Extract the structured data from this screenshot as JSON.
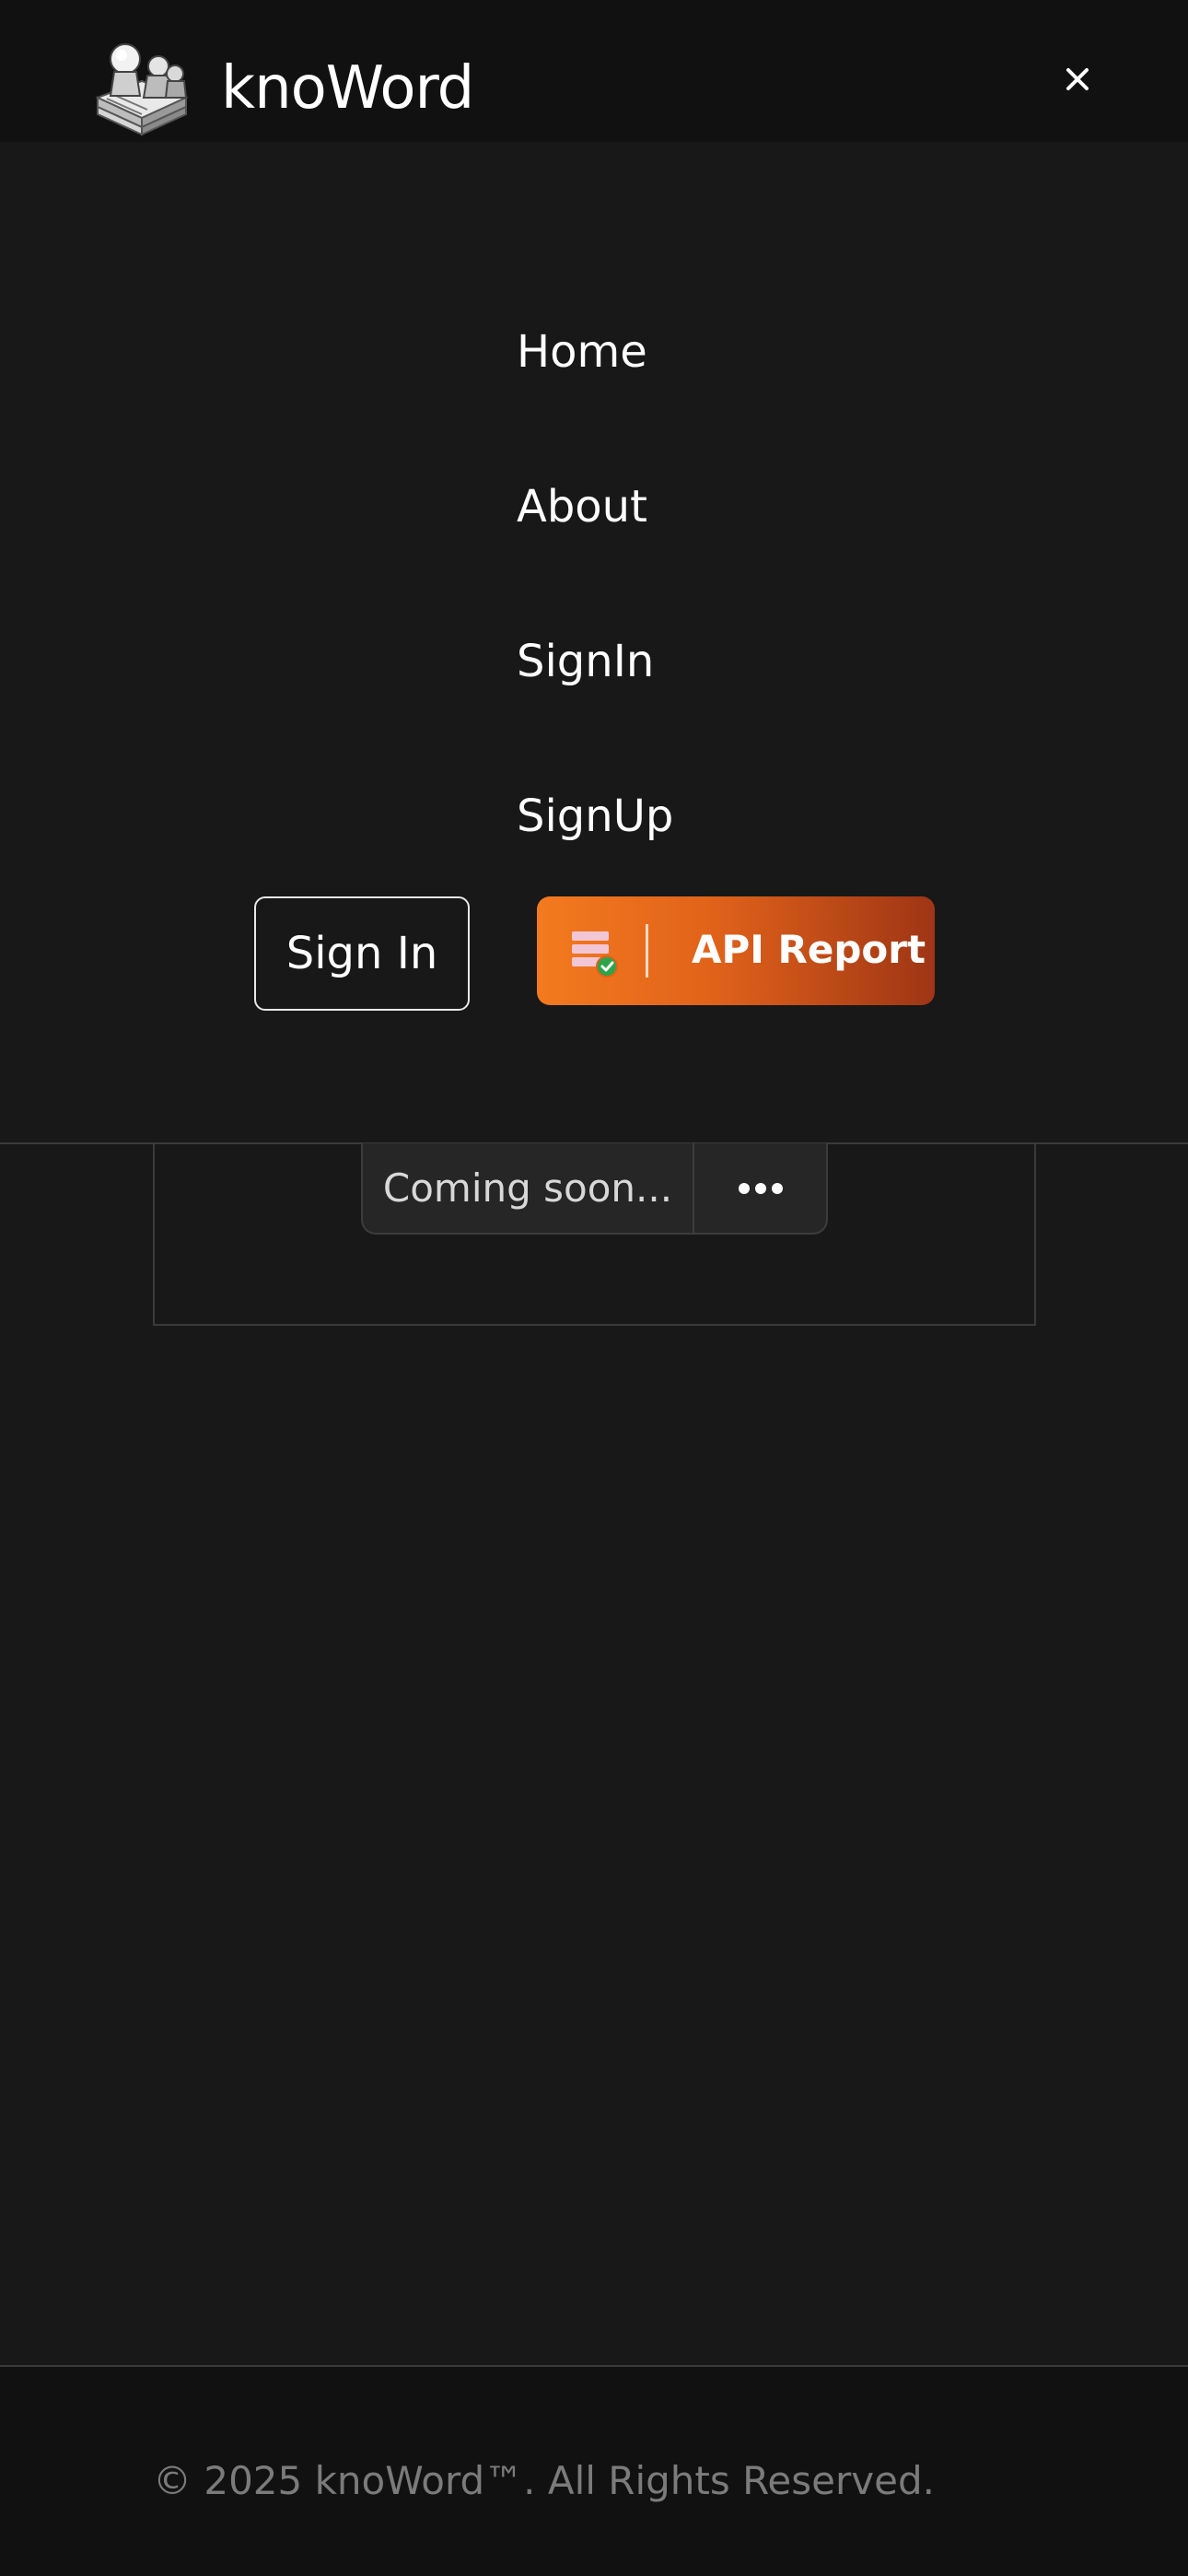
{
  "header": {
    "brand": "knoWord",
    "logo_icon": "book-with-figures-logo",
    "close_icon": "close-icon"
  },
  "menu": {
    "items": [
      {
        "label": "Home"
      },
      {
        "label": "About"
      },
      {
        "label": "SignIn"
      },
      {
        "label": "SignUp"
      }
    ],
    "signin_button": "Sign In",
    "api_button": {
      "label": "API Report",
      "icon": "database-check-icon"
    }
  },
  "content": {
    "status_text": "Coming soon...",
    "more_icon": "more-dots-icon"
  },
  "footer": {
    "copyright": "© 2025 knoWord™. All Rights Reserved."
  },
  "colors": {
    "background": "#181818",
    "header_bg": "#111111",
    "accent_start": "#f47a1f",
    "accent_end": "#9e3515",
    "muted_text": "#7b7b7b"
  }
}
